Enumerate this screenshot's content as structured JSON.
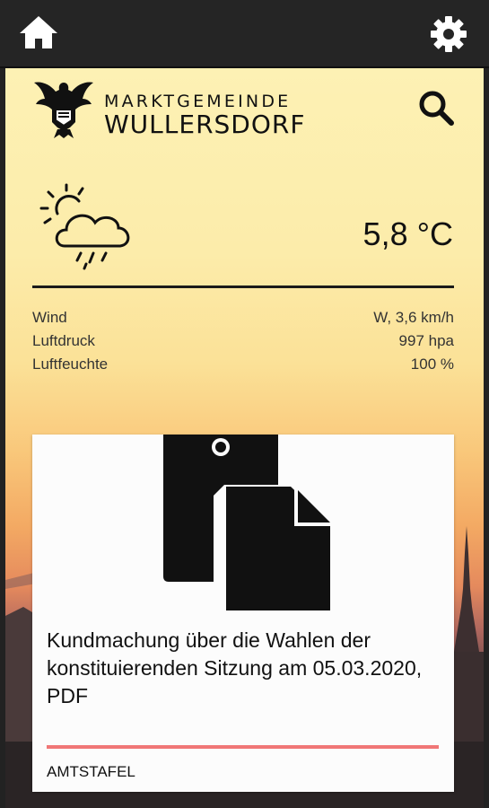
{
  "topbar": {
    "home_icon": "home-icon",
    "settings_icon": "gear-icon"
  },
  "header": {
    "logo_line1": "MARKTGEMEINDE",
    "logo_line2": "WULLERSDORF",
    "search_icon": "search-icon"
  },
  "weather": {
    "icon": "sun-cloud-rain-icon",
    "temperature": "5,8 °C",
    "details": [
      {
        "label": "Wind",
        "value": "W, 3,6 km/h"
      },
      {
        "label": "Luftdruck",
        "value": "997 hpa"
      },
      {
        "label": "Luftfeuchte",
        "value": "100 %"
      }
    ]
  },
  "card": {
    "icon": "documents-icon",
    "title": "Kundmachung über die Wahlen der konstituierenden Sitzung am 05.03.2020, PDF",
    "category": "AMTSTAFEL",
    "accent_color": "#f07777"
  }
}
